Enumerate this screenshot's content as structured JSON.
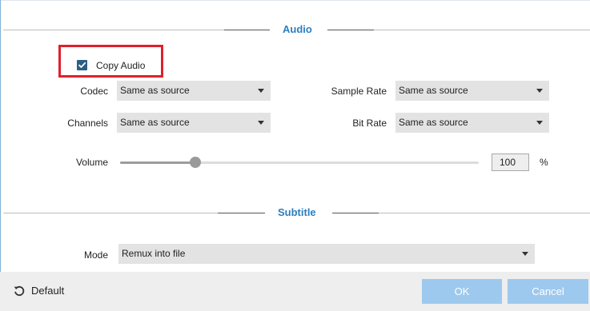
{
  "audio": {
    "section_title": "Audio",
    "copy_audio": {
      "label": "Copy Audio",
      "checked": true
    },
    "codec": {
      "label": "Codec",
      "value": "Same as source"
    },
    "sample_rate": {
      "label": "Sample Rate",
      "value": "Same as source"
    },
    "channels": {
      "label": "Channels",
      "value": "Same as source"
    },
    "bit_rate": {
      "label": "Bit Rate",
      "value": "Same as source"
    },
    "volume": {
      "label": "Volume",
      "value": "100",
      "unit": "%",
      "level_fraction": 0.21
    }
  },
  "subtitle": {
    "section_title": "Subtitle",
    "mode": {
      "label": "Mode",
      "value": "Remux into file"
    }
  },
  "footer": {
    "default_label": "Default",
    "ok_label": "OK",
    "cancel_label": "Cancel"
  },
  "colors": {
    "accent": "#2a7fc0",
    "highlight": "#e0202c",
    "button": "#9ec9ee",
    "checkbox": "#2b5f86"
  },
  "icons": {
    "checkbox": "checkmark-icon",
    "default": "reset-icon",
    "dropdown": "chevron-down-icon"
  }
}
